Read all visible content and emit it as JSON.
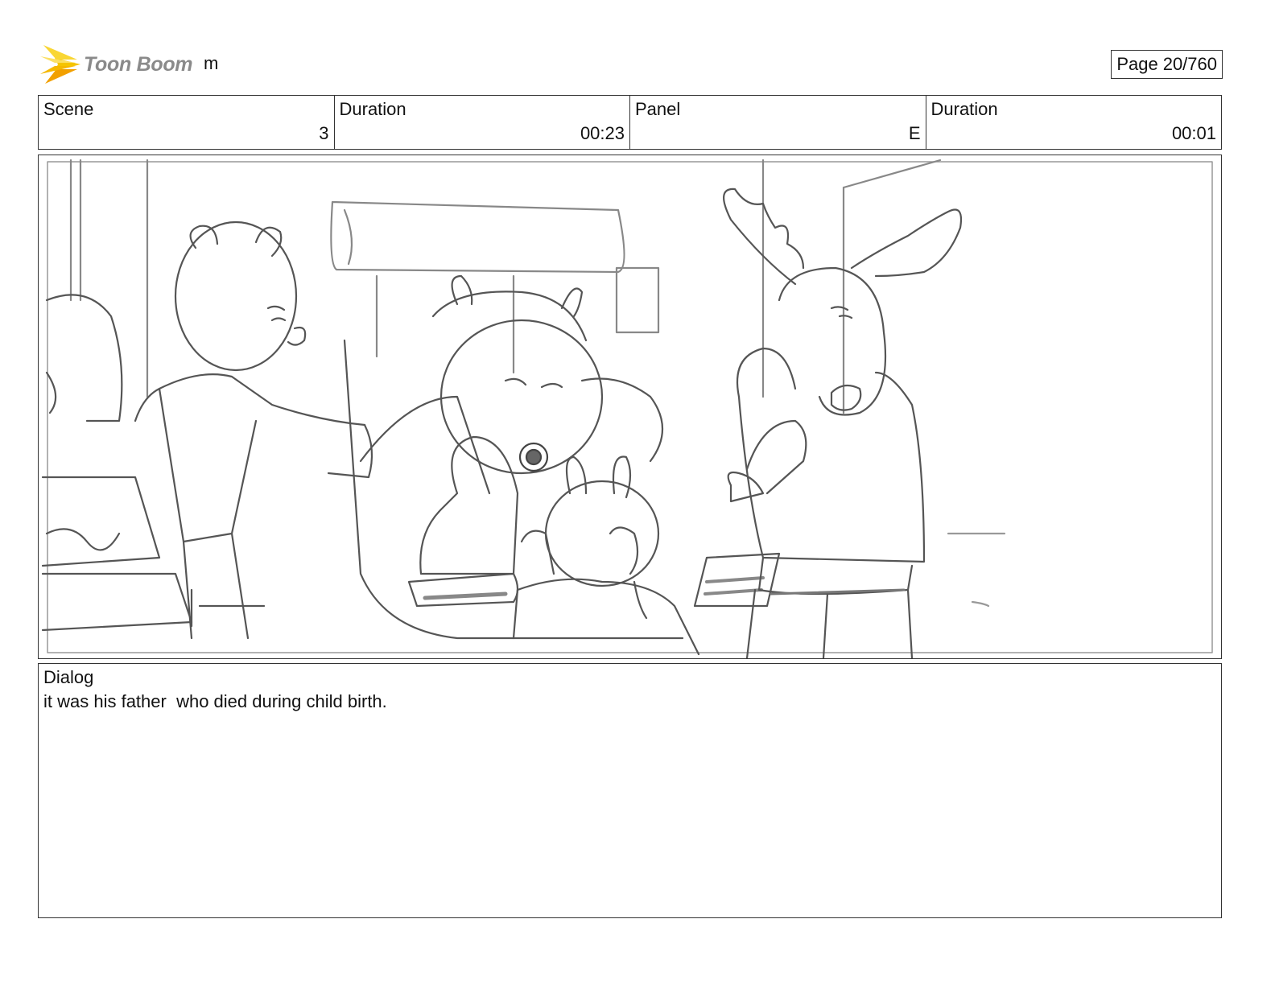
{
  "header": {
    "brand": "Toon Boom",
    "project_name": "m",
    "page_label": "Page",
    "page_value": "20/760"
  },
  "info": {
    "scene_label": "Scene",
    "scene_value": "3",
    "scene_duration_label": "Duration",
    "scene_duration_value": "00:23",
    "panel_label": "Panel",
    "panel_value": "E",
    "panel_duration_label": "Duration",
    "panel_duration_value": "00:01"
  },
  "dialog": {
    "label": "Dialog",
    "text": "it was his father  who died during child birth."
  },
  "colors": {
    "logo_yellow": "#f5c400",
    "logo_orange": "#f2a000",
    "border": "#333333",
    "sketch_line": "#555555"
  }
}
